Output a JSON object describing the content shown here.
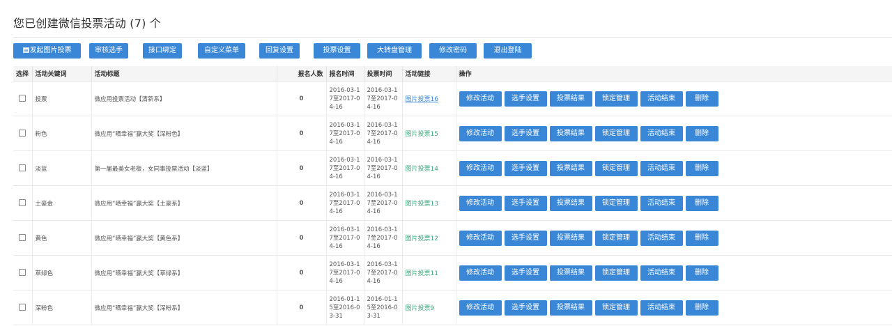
{
  "header": {
    "title": "您已创建微信投票活动 (7) 个"
  },
  "toolbar": {
    "buttons": [
      {
        "label": "发起图片投票",
        "icon": "image-icon"
      },
      {
        "label": "审核选手"
      },
      {
        "label": "接口绑定"
      },
      {
        "label": "自定义菜单"
      },
      {
        "label": "回复设置"
      },
      {
        "label": "投票设置"
      },
      {
        "label": "大转盘管理"
      },
      {
        "label": "修改密码"
      },
      {
        "label": "退出登陆"
      }
    ]
  },
  "table": {
    "columns": [
      "选择",
      "活动关键词",
      "活动标题",
      "报名人数",
      "报名时间",
      "投票时间",
      "活动链接",
      "操作"
    ],
    "action_labels": [
      "修改活动",
      "选手设置",
      "投票结果",
      "锁定管理",
      "活动结束",
      "删除"
    ],
    "rows": [
      {
        "keyword": "投票",
        "title": "微应用投票活动【清新系】",
        "count": "0",
        "signup_time": "2016-03-17至2017-04-16",
        "vote_time": "2016-03-17至2017-04-16",
        "link": "图片投票16"
      },
      {
        "keyword": "粉色",
        "title": "微应用“晒幸福”赢大奖【深粉色】",
        "count": "0",
        "signup_time": "2016-03-17至2017-04-16",
        "vote_time": "2016-03-17至2017-04-16",
        "link": "图片投票15"
      },
      {
        "keyword": "淡蓝",
        "title": "第一届最美女老板，女同事投票活动【淡蓝】",
        "count": "0",
        "signup_time": "2016-03-17至2017-04-16",
        "vote_time": "2016-03-17至2017-04-16",
        "link": "图片投票14"
      },
      {
        "keyword": "土豪金",
        "title": "微应用“晒幸福”赢大奖【土豪系】",
        "count": "0",
        "signup_time": "2016-03-17至2017-04-16",
        "vote_time": "2016-03-17至2017-04-16",
        "link": "图片投票13"
      },
      {
        "keyword": "黄色",
        "title": "微应用“晒幸福”赢大奖【黄色系】",
        "count": "0",
        "signup_time": "2016-03-17至2017-04-16",
        "vote_time": "2016-03-17至2017-04-16",
        "link": "图片投票12"
      },
      {
        "keyword": "草绿色",
        "title": "微应用“晒幸福”赢大奖【草绿系】",
        "count": "0",
        "signup_time": "2016-03-17至2017-04-16",
        "vote_time": "2016-03-17至2017-04-16",
        "link": "图片投票11"
      },
      {
        "keyword": "深粉色",
        "title": "微应用“晒幸福”赢大奖【深粉系】",
        "count": "0",
        "signup_time": "2016-01-15至2016-03-31",
        "vote_time": "2016-01-15至2016-03-31",
        "link": "图片投票9"
      }
    ]
  },
  "colors": {
    "accent": "#3a87d8",
    "link_green": "#3aa87c",
    "header_bg": "#f5f5f5"
  }
}
